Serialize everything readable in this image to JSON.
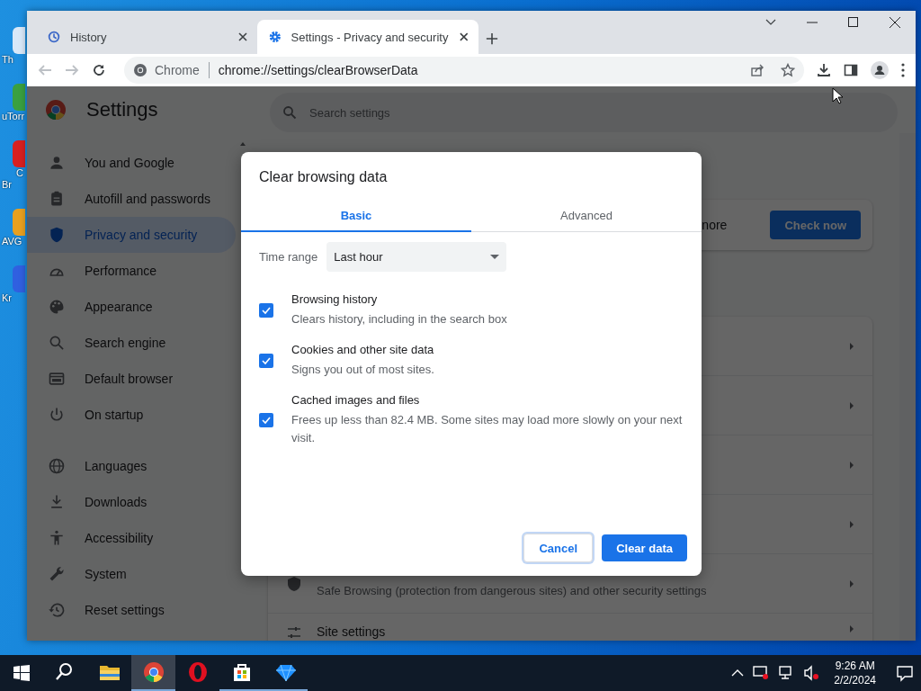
{
  "desktop_icons": [
    {
      "lines": [
        "Th"
      ]
    },
    {
      "lines": [
        "uTorr"
      ]
    },
    {
      "lines": [
        "C",
        "Br"
      ]
    },
    {
      "lines": [
        "AVG"
      ]
    },
    {
      "lines": [
        "Kr"
      ]
    }
  ],
  "browser": {
    "tabs": [
      {
        "title": "History",
        "selected": false
      },
      {
        "title": "Settings - Privacy and security",
        "selected": true
      }
    ],
    "address": {
      "site_label": "Chrome",
      "url": "chrome://settings/clearBrowserData"
    }
  },
  "settings": {
    "title": "Settings",
    "search": {
      "placeholder": "Search settings"
    },
    "nav": [
      {
        "items": [
          {
            "label": "You and Google",
            "selected": false
          },
          {
            "label": "Autofill and passwords",
            "selected": false
          },
          {
            "label": "Privacy and security",
            "selected": true
          },
          {
            "label": "Performance",
            "selected": false
          },
          {
            "label": "Appearance",
            "selected": false
          },
          {
            "label": "Search engine",
            "selected": false
          },
          {
            "label": "Default browser",
            "selected": false
          },
          {
            "label": "On startup",
            "selected": false
          }
        ]
      },
      {
        "items": [
          {
            "label": "Languages",
            "selected": false
          },
          {
            "label": "Downloads",
            "selected": false
          },
          {
            "label": "Accessibility",
            "selected": false
          },
          {
            "label": "System",
            "selected": false
          },
          {
            "label": "Reset settings",
            "selected": false
          }
        ]
      }
    ],
    "safety_check": {
      "text_fragment": "nore",
      "button": "Check now"
    },
    "privacy_rows": {
      "safe_browsing_description": "Safe Browsing (protection from dangerous sites) and other security settings",
      "site_settings": "Site settings"
    }
  },
  "dialog": {
    "title": "Clear browsing data",
    "tabs": [
      {
        "label": "Basic",
        "selected": true
      },
      {
        "label": "Advanced",
        "selected": false
      }
    ],
    "time_range": {
      "label": "Time range",
      "value": "Last hour"
    },
    "options": [
      {
        "title": "Browsing history",
        "description": "Clears history, including in the search box",
        "checked": true
      },
      {
        "title": "Cookies and other site data",
        "description": "Signs you out of most sites.",
        "checked": true
      },
      {
        "title": "Cached images and files",
        "description": "Frees up less than 82.4 MB. Some sites may load more slowly on your next visit.",
        "checked": true
      }
    ],
    "buttons": [
      {
        "label": "Cancel",
        "kind": "secondary"
      },
      {
        "label": "Clear data",
        "kind": "primary"
      }
    ]
  },
  "taskbar": {
    "apps": [
      {
        "kind": "search",
        "running": false,
        "selected": false
      },
      {
        "kind": "folder",
        "running": false,
        "selected": false
      },
      {
        "kind": "chrome",
        "running": true,
        "selected": true
      },
      {
        "kind": "opera",
        "running": false,
        "selected": false
      },
      {
        "kind": "store",
        "running": true,
        "selected": false
      },
      {
        "kind": "gem",
        "running": true,
        "selected": false
      }
    ],
    "clock": {
      "time": "9:26 AM",
      "date": "2/2/2024"
    }
  }
}
